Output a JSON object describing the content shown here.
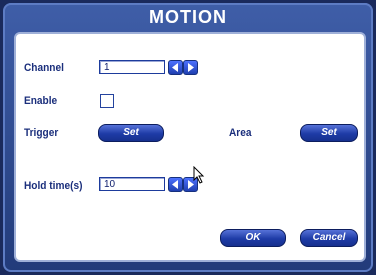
{
  "dialog": {
    "title": "MOTION"
  },
  "channel": {
    "label": "Channel",
    "value": "1"
  },
  "enable": {
    "label": "Enable",
    "checked": false
  },
  "trigger": {
    "label": "Trigger",
    "button": "Set"
  },
  "area": {
    "label": "Area",
    "button": "Set"
  },
  "hold": {
    "label": "Hold time(s)",
    "value": "10"
  },
  "footer": {
    "ok": "OK",
    "cancel": "Cancel"
  }
}
